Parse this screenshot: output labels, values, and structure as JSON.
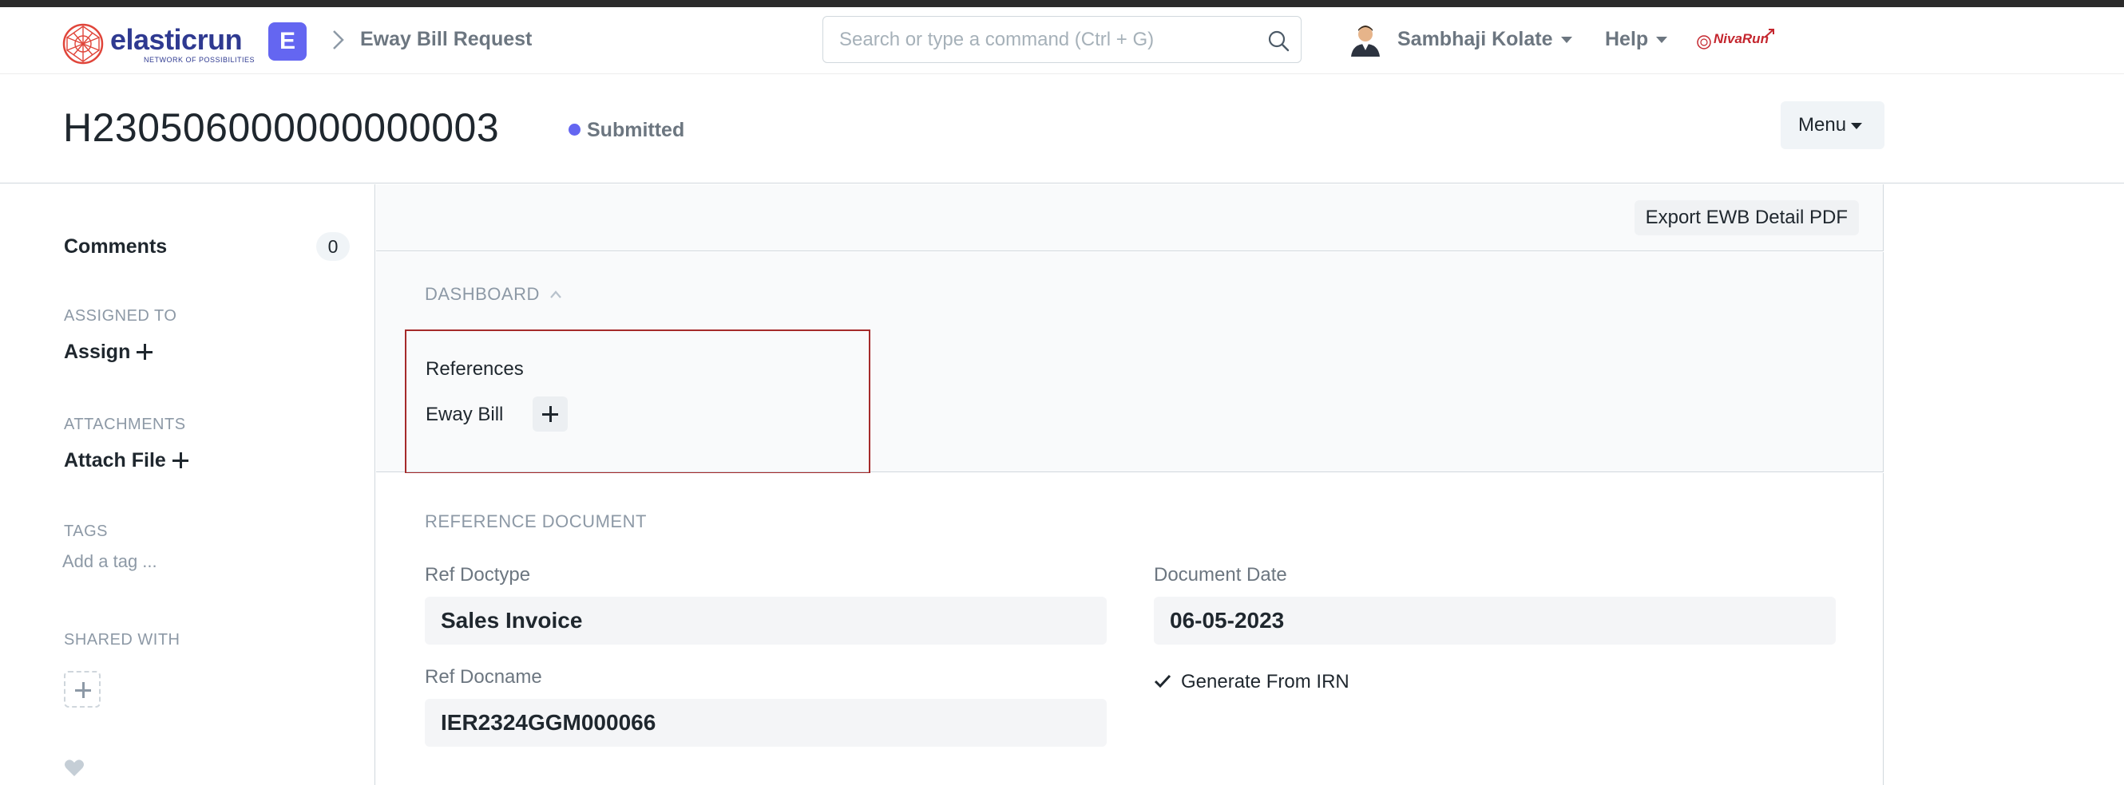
{
  "brand": {
    "name": "elasticrun",
    "tagline": "NETWORK OF POSSIBILITIES",
    "app_badge": "E",
    "partner_logo_text": "NivaRun"
  },
  "navbar": {
    "breadcrumb": "Eway Bill Request",
    "search_placeholder": "Search or type a command (Ctrl + G)",
    "user_name": "Sambhaji Kolate",
    "help_label": "Help"
  },
  "page": {
    "title": "H230506000000000003",
    "status": "Submitted",
    "status_color": "#6466f1",
    "menu_label": "Menu"
  },
  "sidebar": {
    "comments_label": "Comments",
    "comments_count": "0",
    "assigned_label": "ASSIGNED TO",
    "assign_action": "Assign",
    "attachments_label": "ATTACHMENTS",
    "attach_action": "Attach File",
    "tags_label": "TAGS",
    "tag_placeholder": "Add a tag ...",
    "shared_label": "SHARED WITH"
  },
  "toolbar": {
    "export_label": "Export EWB Detail PDF"
  },
  "dashboard": {
    "heading": "DASHBOARD",
    "references_title": "References",
    "reference_item": "Eway Bill"
  },
  "reference_document": {
    "heading": "REFERENCE DOCUMENT",
    "ref_doctype_label": "Ref Doctype",
    "ref_doctype_value": "Sales Invoice",
    "ref_docname_label": "Ref Docname",
    "ref_docname_value": "IER2324GGM000066",
    "document_date_label": "Document Date",
    "document_date_value": "06-05-2023",
    "generate_from_irn_label": "Generate From IRN"
  }
}
